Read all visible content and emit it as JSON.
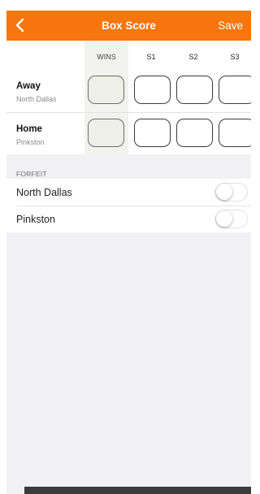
{
  "nav": {
    "title": "Box Score",
    "save_label": "Save",
    "back_icon": "chevron-left-icon",
    "bar_color": "#f7760d"
  },
  "score_table": {
    "columns": [
      "WINS",
      "S1",
      "S2",
      "S3"
    ],
    "teams": [
      {
        "role": "Away",
        "name": "North Dallas"
      },
      {
        "role": "Home",
        "name": "Pinkston"
      }
    ]
  },
  "forfeit": {
    "header": "FORFEIT",
    "rows": [
      {
        "label": "North Dallas",
        "on": false
      },
      {
        "label": "Pinkston",
        "on": false
      }
    ]
  }
}
